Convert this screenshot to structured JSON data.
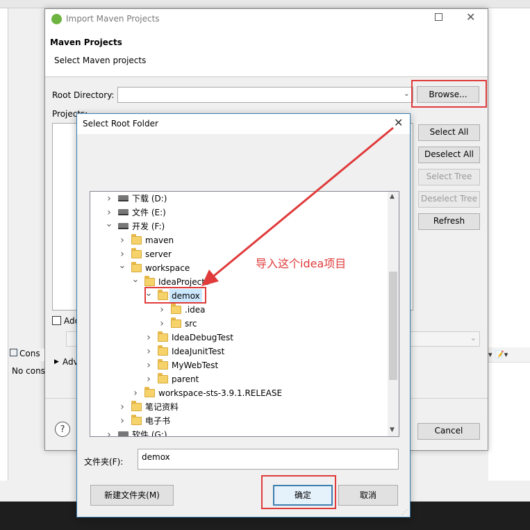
{
  "maven_dialog": {
    "title": "Import Maven Projects",
    "header_title": "Maven Projects",
    "header_subtitle": "Select Maven projects",
    "root_directory_label": "Root Directory:",
    "root_directory_value": "",
    "browse_label": "Browse...",
    "projects_label": "Projects:",
    "select_all": "Select All",
    "deselect_all": "Deselect All",
    "select_tree": "Select Tree",
    "deselect_tree": "Deselect Tree",
    "refresh": "Refresh",
    "add_checkbox_label": "Add",
    "advanced_label": "Adv",
    "cancel": "Cancel"
  },
  "background": {
    "console_tab": "Cons",
    "console_text": "No cons"
  },
  "folder_dialog": {
    "title": "Select Root Folder",
    "folder_label": "文件夹(F):",
    "folder_value": "demox",
    "new_folder": "新建文件夹(M)",
    "ok": "确定",
    "cancel": "取消"
  },
  "tree": [
    {
      "label": "下载 (D:)",
      "type": "drive",
      "expanded": false
    },
    {
      "label": "文件 (E:)",
      "type": "drive",
      "expanded": false
    },
    {
      "label": "开发 (F:)",
      "type": "drive",
      "expanded": true
    },
    {
      "label": "maven",
      "type": "folder",
      "expanded": false
    },
    {
      "label": "server",
      "type": "folder",
      "expanded": false
    },
    {
      "label": "workspace",
      "type": "folder",
      "expanded": true
    },
    {
      "label": "IdeaProjects",
      "type": "folder",
      "expanded": true
    },
    {
      "label": "demox",
      "type": "folder",
      "expanded": true,
      "selected": true
    },
    {
      "label": ".idea",
      "type": "folder",
      "expanded": false
    },
    {
      "label": "src",
      "type": "folder",
      "expanded": false
    },
    {
      "label": "IdeaDebugTest",
      "type": "folder",
      "expanded": false
    },
    {
      "label": "IdeaJunitTest",
      "type": "folder",
      "expanded": false
    },
    {
      "label": "MyWebTest",
      "type": "folder",
      "expanded": false
    },
    {
      "label": "parent",
      "type": "folder",
      "expanded": false
    },
    {
      "label": "workspace-sts-3.9.1.RELEASE",
      "type": "folder",
      "expanded": false
    },
    {
      "label": "笔记资料",
      "type": "folder",
      "expanded": false
    },
    {
      "label": "电子书",
      "type": "folder",
      "expanded": false
    },
    {
      "label": "软件 (G:)",
      "type": "drive",
      "expanded": false
    }
  ],
  "annotation": {
    "text": "导入这个idea项目",
    "color": "#e03a3a"
  }
}
